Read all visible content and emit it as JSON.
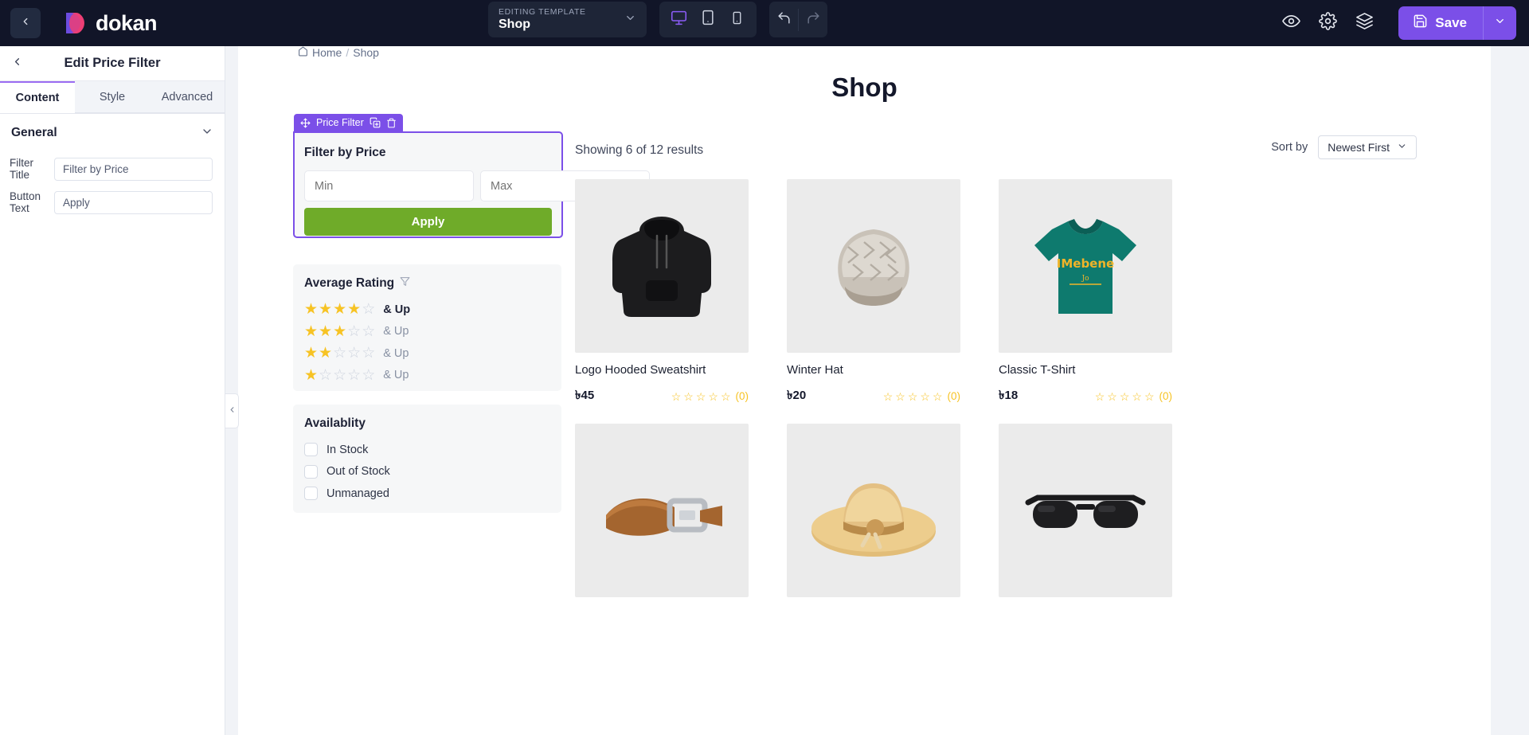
{
  "topbar": {
    "back_icon": "chevron-left-icon",
    "logo_text": "dokan",
    "template": {
      "label": "EDITING TEMPLATE",
      "value": "Shop",
      "chevron": "chevron-down-icon"
    },
    "devices": [
      {
        "name": "desktop",
        "icon": "desktop-icon",
        "active": true
      },
      {
        "name": "tablet",
        "icon": "tablet-icon",
        "active": false
      },
      {
        "name": "mobile",
        "icon": "mobile-icon",
        "active": false
      }
    ],
    "history": [
      {
        "name": "undo",
        "icon": "undo-icon"
      },
      {
        "name": "redo",
        "icon": "redo-icon"
      }
    ],
    "tools": [
      {
        "name": "preview",
        "icon": "eye-icon"
      },
      {
        "name": "settings",
        "icon": "gear-icon"
      },
      {
        "name": "layers",
        "icon": "layers-icon"
      }
    ],
    "save": {
      "label": "Save",
      "icon": "save-disk-icon",
      "chevron": "chevron-down-icon",
      "color": "#7b4fe8"
    }
  },
  "panel": {
    "back_icon": "chevron-left-icon",
    "title": "Edit Price Filter",
    "tabs": [
      {
        "label": "Content",
        "active": true
      },
      {
        "label": "Style",
        "active": false
      },
      {
        "label": "Advanced",
        "active": false
      }
    ],
    "section": {
      "title": "General",
      "chevron": "chevron-down-icon"
    },
    "fields": [
      {
        "label": "Filter Title",
        "value": "Filter by Price",
        "placeholder": "Filter by Price"
      },
      {
        "label": "Button Text",
        "value": "Apply",
        "placeholder": "Apply"
      }
    ],
    "collapse_icon": "chevron-left-icon"
  },
  "canvas": {
    "breadcrumb": {
      "home": "Home",
      "sep": "/",
      "current": "Shop",
      "icon": "home-icon"
    },
    "page_title": "Shop",
    "widget_badge": {
      "label": "Price Filter",
      "move_icon": "move-arrows-icon",
      "duplicate_icon": "duplicate-icon",
      "delete_icon": "trash-icon"
    },
    "price_filter": {
      "title": "Filter by Price",
      "min_placeholder": "Min",
      "max_placeholder": "Max",
      "apply_label": "Apply",
      "apply_color": "#6fab29"
    },
    "rating": {
      "title": "Average Rating",
      "filter_icon": "funnel-icon",
      "rows": [
        {
          "filled": 4,
          "label": "& Up"
        },
        {
          "filled": 3,
          "label": "& Up"
        },
        {
          "filled": 2,
          "label": "& Up"
        },
        {
          "filled": 1,
          "label": "& Up"
        }
      ]
    },
    "availability": {
      "title": "Availablity",
      "options": [
        {
          "label": "In Stock",
          "checked": false
        },
        {
          "label": "Out of Stock",
          "checked": false
        },
        {
          "label": "Unmanaged",
          "checked": false
        }
      ]
    },
    "results_text": "Showing 6 of 12 results",
    "sort": {
      "label": "Sort by",
      "value": "Newest First",
      "chevron": "chevron-down-icon"
    },
    "products": [
      {
        "name": "Logo Hooded Sweatshirt",
        "price": "৳45",
        "rating": 0,
        "reviews": "(0)",
        "image": "hoodie"
      },
      {
        "name": "Winter Hat",
        "price": "৳20",
        "rating": 0,
        "reviews": "(0)",
        "image": "beanie"
      },
      {
        "name": "Classic T-Shirt",
        "price": "৳18",
        "rating": 0,
        "reviews": "(0)",
        "image": "tshirt"
      },
      {
        "name": "",
        "price": "",
        "rating": 0,
        "reviews": "",
        "image": "belt"
      },
      {
        "name": "",
        "price": "",
        "rating": 0,
        "reviews": "",
        "image": "strawhat"
      },
      {
        "name": "",
        "price": "",
        "rating": 0,
        "reviews": "",
        "image": "sunglasses"
      }
    ]
  }
}
